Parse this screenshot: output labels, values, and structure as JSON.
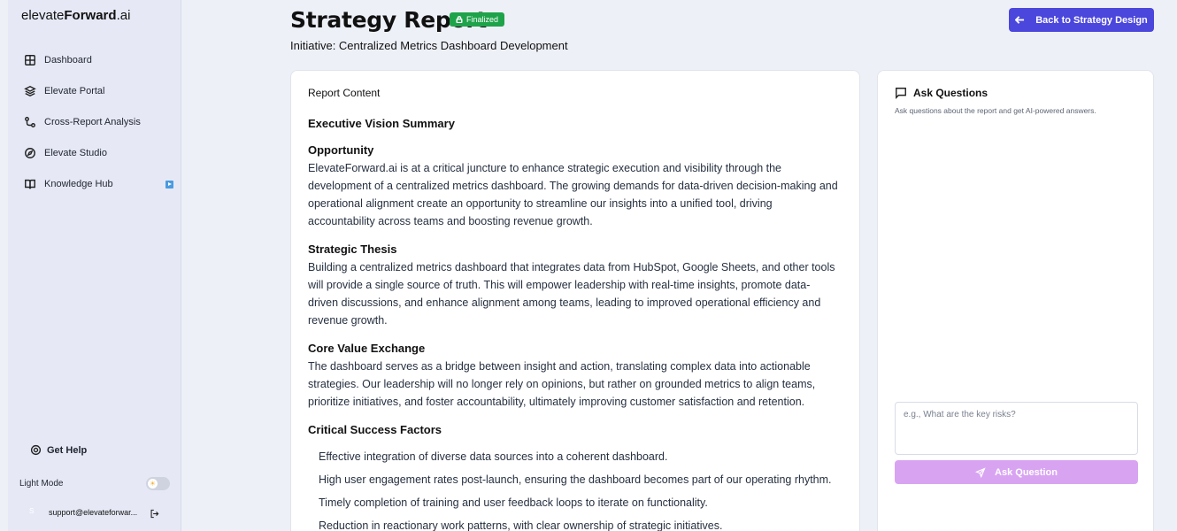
{
  "sidebar": {
    "logo_prefix": "elevate",
    "logo_bold": "Forward",
    "logo_suffix": ".ai",
    "items": [
      {
        "label": "Dashboard",
        "icon": "grid-icon"
      },
      {
        "label": "Elevate Portal",
        "icon": "layers-icon"
      },
      {
        "label": "Cross-Report Analysis",
        "icon": "route-icon"
      },
      {
        "label": "Elevate Studio",
        "icon": "compass-icon"
      },
      {
        "label": "Knowledge Hub",
        "icon": "book-icon"
      }
    ],
    "get_help": "Get Help",
    "light_mode": "Light Mode",
    "avatar_initial": "S",
    "user_email": "support@elevateforwar..."
  },
  "header": {
    "title": "Strategy Report",
    "status_badge": "Finalized",
    "subtitle": "Initiative: Centralized Metrics Dashboard Development",
    "back_button": "Back to Strategy Design"
  },
  "report": {
    "label": "Report Content",
    "heading": "Executive Vision Summary",
    "sections": [
      {
        "title": "Opportunity",
        "body": "ElevateForward.ai is at a critical juncture to enhance strategic execution and visibility through the development of a centralized metrics dashboard. The growing demands for data-driven decision-making and operational alignment create an opportunity to streamline our insights into a unified tool, driving accountability across teams and boosting revenue growth."
      },
      {
        "title": "Strategic Thesis",
        "body": "Building a centralized metrics dashboard that integrates data from HubSpot, Google Sheets, and other tools will provide a single source of truth. This will empower leadership with real-time insights, promote data-driven discussions, and enhance alignment among teams, leading to improved operational efficiency and revenue growth."
      },
      {
        "title": "Core Value Exchange",
        "body": "The dashboard serves as a bridge between insight and action, translating complex data into actionable strategies. Our leadership will no longer rely on opinions, but rather on grounded metrics to align teams, prioritize initiatives, and foster accountability, ultimately improving customer satisfaction and retention."
      }
    ],
    "csf_title": "Critical Success Factors",
    "csf_items": [
      "Effective integration of diverse data sources into a coherent dashboard.",
      "High user engagement rates post-launch, ensuring the dashboard becomes part of our operating rhythm.",
      "Timely completion of training and user feedback loops to iterate on functionality.",
      "Reduction in reactionary work patterns, with clear ownership of strategic initiatives."
    ]
  },
  "ask": {
    "title": "Ask Questions",
    "description": "Ask questions about the report and get AI-powered answers.",
    "placeholder": "e.g., What are the key risks?",
    "button": "Ask Question"
  },
  "colors": {
    "primary": "#4b46dc",
    "badge": "#1fa34a",
    "ask_button": "#d8a4f2",
    "background": "#eef0f8"
  }
}
